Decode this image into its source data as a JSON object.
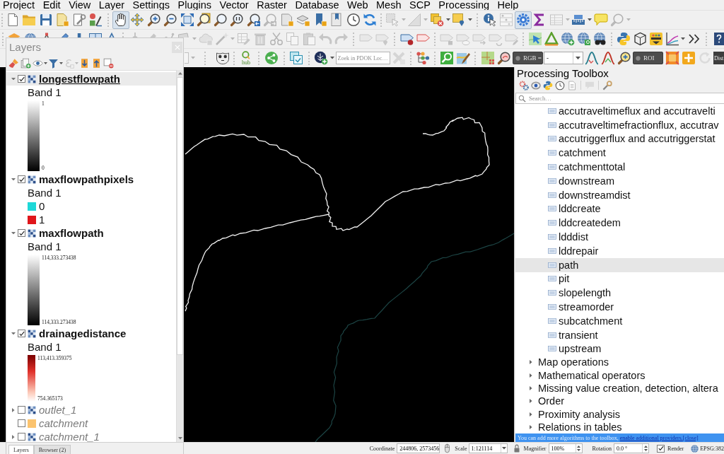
{
  "menu": [
    "Project",
    "Edit",
    "View",
    "Layer",
    "Settings",
    "Plugins",
    "Vector",
    "Raster",
    "Database",
    "Web",
    "Mesh",
    "SCP",
    "Processing",
    "Help"
  ],
  "toolbars": [
    {
      "buttons": [
        {
          "disabled": false,
          "on": false
        },
        {
          "disabled": false,
          "on": false
        },
        {
          "disabled": false,
          "on": false
        },
        {
          "disabled": false,
          "on": false
        },
        {
          "disabled": false,
          "on": false
        },
        {
          "disabled": false,
          "on": false
        },
        {
          "disabled": false,
          "on": true
        },
        {
          "disabled": false,
          "on": false
        },
        {
          "disabled": false,
          "on": false
        },
        {
          "disabled": false,
          "on": false
        },
        {
          "disabled": false,
          "on": false
        },
        {
          "disabled": false,
          "on": false
        },
        {
          "disabled": false,
          "on": false
        },
        {
          "disabled": false,
          "on": false
        },
        {
          "disabled": false,
          "on": false
        },
        {
          "disabled": true,
          "on": false
        },
        {
          "disabled": false,
          "on": false
        },
        {
          "disabled": false,
          "on": false
        },
        {
          "disabled": false,
          "on": false
        },
        {
          "disabled": false,
          "on": false
        },
        {
          "disabled": false,
          "on": false
        },
        {
          "disabled": false,
          "on": false
        },
        {
          "disabled": true,
          "on": false
        },
        {
          "disabled": true,
          "on": false
        },
        {
          "disabled": false,
          "on": false
        },
        {
          "disabled": false,
          "on": false
        },
        {
          "disabled": false,
          "on": false
        },
        {
          "disabled": true,
          "on": false
        },
        {
          "disabled": false,
          "on": true
        },
        {
          "disabled": false,
          "on": false
        },
        {
          "disabled": true,
          "on": false
        },
        {
          "disabled": false,
          "on": false
        },
        {
          "disabled": false,
          "on": false
        },
        {
          "disabled": true,
          "on": false
        }
      ]
    },
    {
      "buttons": [
        {
          "disabled": false,
          "on": false
        },
        {
          "disabled": false,
          "on": false
        },
        {
          "disabled": false,
          "on": false
        },
        {
          "disabled": false,
          "on": false
        },
        {
          "disabled": false,
          "on": false
        },
        {
          "disabled": false,
          "on": false
        },
        {
          "disabled": false,
          "on": false
        },
        {
          "disabled": true,
          "on": false
        },
        {
          "disabled": true,
          "on": false
        },
        {
          "disabled": true,
          "on": false
        },
        {
          "disabled": true,
          "on": false
        },
        {
          "disabled": true,
          "on": false
        },
        {
          "disabled": true,
          "on": false
        },
        {
          "disabled": true,
          "on": false
        },
        {
          "disabled": true,
          "on": false
        },
        {
          "disabled": true,
          "on": false
        },
        {
          "disabled": true,
          "on": false
        },
        {
          "disabled": true,
          "on": false
        },
        {
          "disabled": true,
          "on": false
        },
        {
          "disabled": true,
          "on": false
        },
        {
          "disabled": true,
          "on": false
        },
        {
          "disabled": true,
          "on": false
        },
        {
          "disabled": false,
          "on": false
        },
        {
          "disabled": false,
          "on": false
        },
        {
          "disabled": true,
          "on": false
        },
        {
          "disabled": true,
          "on": false
        },
        {
          "disabled": true,
          "on": false
        },
        {
          "disabled": true,
          "on": false
        },
        {
          "disabled": true,
          "on": false
        },
        {
          "disabled": false,
          "on": false
        },
        {
          "disabled": false,
          "on": false
        },
        {
          "disabled": false,
          "on": false
        },
        {
          "disabled": false,
          "on": false
        },
        {
          "disabled": false,
          "on": false
        },
        {
          "disabled": false,
          "on": false
        },
        {
          "disabled": false,
          "on": false
        },
        {
          "disabled": false,
          "on": false
        },
        {
          "disabled": false,
          "on": false
        },
        {
          "disabled": false,
          "on": false
        },
        {
          "disabled": false,
          "on": false
        }
      ]
    },
    {
      "buttons": [
        {
          "disabled": true,
          "on": false
        },
        {
          "disabled": false,
          "on": false
        },
        {
          "disabled": false,
          "on": false
        },
        {
          "disabled": false,
          "on": false
        },
        {
          "disabled": false,
          "on": false
        },
        {
          "disabled": false,
          "on": false
        },
        {
          "disabled": true,
          "on": false
        },
        {
          "disabled": false,
          "on": false
        },
        {
          "disabled": false,
          "on": false
        },
        {
          "disabled": false,
          "on": false
        },
        {
          "disabled": false,
          "on": false
        },
        {
          "disabled": false,
          "on": false
        },
        {
          "disabled": false,
          "on": false
        },
        {
          "disabled": false,
          "on": false
        },
        {
          "disabled": false,
          "on": false
        },
        {
          "disabled": false,
          "on": false
        },
        {
          "disabled": false,
          "on": false
        },
        {
          "disabled": true,
          "on": false
        }
      ],
      "hub_label": "hub",
      "locator_placeholder": "Zoek in PDOK Loc…",
      "band_button": "RGB =",
      "band_value": "-",
      "roi_button": "ROI",
      "dist_label": "Dist"
    }
  ],
  "layers_panel": {
    "title": "Layers",
    "tools": [
      {
        "disabled": false
      },
      {
        "disabled": false
      },
      {
        "disabled": false
      },
      {
        "disabled": false
      },
      {
        "disabled": true
      },
      {
        "disabled": false
      },
      {
        "disabled": false
      },
      {
        "disabled": false
      }
    ],
    "layers": [
      {
        "name": "longestflowpath",
        "kind": "raster",
        "checked": true,
        "expanded": true,
        "selected": true,
        "legend": {
          "band": "Band 1",
          "kind": "greyscale",
          "max": "1",
          "min": "0"
        }
      },
      {
        "name": "maxflowpathpixels",
        "kind": "raster",
        "checked": true,
        "expanded": true,
        "selected": false,
        "legend": {
          "band": "Band 1",
          "kind": "paletted",
          "classes": [
            {
              "label": "0",
              "color": "#1ed8d8"
            },
            {
              "label": "1",
              "color": "#e0161b"
            }
          ]
        }
      },
      {
        "name": "maxflowpath",
        "kind": "raster",
        "checked": true,
        "expanded": true,
        "selected": false,
        "legend": {
          "band": "Band 1",
          "kind": "greyscale",
          "max": "114,333.273438",
          "min": "114,333.273438"
        }
      },
      {
        "name": "drainagedistance",
        "kind": "raster",
        "checked": true,
        "expanded": true,
        "selected": false,
        "legend": {
          "band": "Band 1",
          "kind": "pseudocolor",
          "max": "113,413.359375",
          "min": "754.365173"
        }
      },
      {
        "name": "outlet_1",
        "kind": "raster",
        "checked": false,
        "expanded": false,
        "selected": false
      },
      {
        "name": "catchment",
        "kind": "vector",
        "color": "#fbc36e",
        "checked": false,
        "expanded": false,
        "selected": false
      },
      {
        "name": "catchment_1",
        "kind": "raster",
        "checked": false,
        "expanded": false,
        "selected": false
      }
    ],
    "tabs": [
      {
        "label": "Layers",
        "selected": true
      },
      {
        "label": "Browser (2)",
        "selected": false
      }
    ]
  },
  "processing_toolbox": {
    "title": "Processing Toolbox",
    "tools": [
      {
        "disabled": false
      },
      {
        "disabled": false
      },
      {
        "disabled": false
      },
      {
        "disabled": false
      },
      {
        "disabled": false
      },
      {
        "disabled": true
      },
      {
        "disabled": false
      }
    ],
    "search_placeholder": "Search…",
    "algorithms": [
      {
        "name": "accutraveltimeflux and accutravelti",
        "selected": false
      },
      {
        "name": "accutraveltimefractionflux, accutrav",
        "selected": false
      },
      {
        "name": "accutriggerflux and accutriggerstat",
        "selected": false
      },
      {
        "name": "catchment",
        "selected": false
      },
      {
        "name": "catchmenttotal",
        "selected": false
      },
      {
        "name": "downstream",
        "selected": false
      },
      {
        "name": "downstreamdist",
        "selected": false
      },
      {
        "name": "lddcreate",
        "selected": false
      },
      {
        "name": "lddcreatedem",
        "selected": false
      },
      {
        "name": "ldddist",
        "selected": false
      },
      {
        "name": "lddrepair",
        "selected": false
      },
      {
        "name": "path",
        "selected": true
      },
      {
        "name": "pit",
        "selected": false
      },
      {
        "name": "slopelength",
        "selected": false
      },
      {
        "name": "streamorder",
        "selected": false
      },
      {
        "name": "subcatchment",
        "selected": false
      },
      {
        "name": "transient",
        "selected": false
      },
      {
        "name": "upstream",
        "selected": false
      }
    ],
    "groups": [
      {
        "name": "Map operations",
        "expanded": false
      },
      {
        "name": "Mathematical operators",
        "expanded": false
      },
      {
        "name": "Missing value creation, detection, altera",
        "expanded": false
      },
      {
        "name": "Order",
        "expanded": false
      },
      {
        "name": "Proximity analysis",
        "expanded": false
      },
      {
        "name": "Relations in tables",
        "expanded": false
      }
    ],
    "notice": {
      "text": "You can add more algorithms to the toolbox,",
      "link": "enable additional providers.",
      "close": "[close]"
    }
  },
  "status_bar": {
    "coordinate_label": "Coordinate",
    "coordinate": "244806, 2573456",
    "scale_label": "Scale",
    "scale": "1:121114",
    "magnifier_label": "Magnifier",
    "magnifier": "100%",
    "rotation_label": "Rotation",
    "rotation": "0.0 °",
    "render_checked": true,
    "render_label": "Render",
    "crs": "EPSG:382"
  }
}
